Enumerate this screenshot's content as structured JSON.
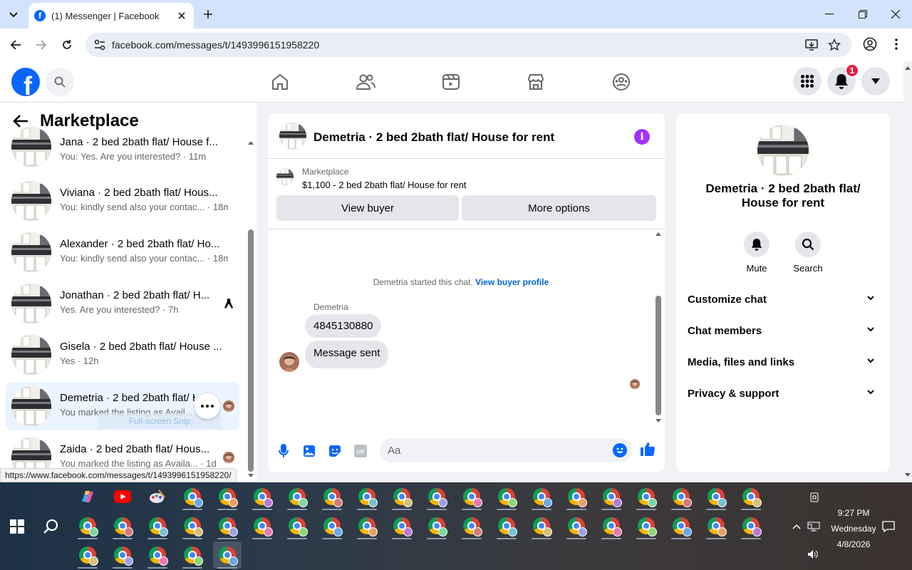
{
  "browser": {
    "tab_title": "(1) Messenger | Facebook",
    "url": "facebook.com/messages/t/1493996151958220",
    "status_url": "https://www.facebook.com/messages/t/1493996151958220/"
  },
  "header": {
    "notification_count": "1"
  },
  "marketplace": {
    "title": "Marketplace",
    "conversations": [
      {
        "name": "Jana · 2 bed 2bath flat/ House f...",
        "preview": "You: Yes. Are you interested? · 11m"
      },
      {
        "name": "Viviana · 2 bed 2bath flat/ Hous...",
        "preview": "You: kindly send also your contac... · 18m"
      },
      {
        "name": "Alexander · 2 bed 2bath flat/ Ho...",
        "preview": "You: kindly send also your contac... · 18m"
      },
      {
        "name": "Jonathan · 2 bed 2bath flat/ H...",
        "preview": "Yes. Are you interested? · 7h"
      },
      {
        "name": "Gisela · 2 bed 2bath flat/ House ...",
        "preview": "Yes · 12h"
      },
      {
        "name": "Demetria · 2 bed 2bath flat/ H...",
        "preview": "You marked the listing as Avail..."
      },
      {
        "name": "Zaida · 2 bed 2bath flat/ Hous...",
        "preview": "You marked the listing as Availa... · 1d"
      }
    ],
    "snip_overlay": "Full-screen Snip"
  },
  "chat": {
    "title": "Demetria · 2 bed 2bath flat/ House for rent",
    "listing_source": "Marketplace",
    "listing_item": "$1,100 - 2 bed 2bath flat/ House for rent",
    "view_buyer_label": "View buyer",
    "more_options_label": "More options",
    "started_text": "Demetria started this chat.",
    "view_profile_link": "View buyer profile",
    "sender_name": "Demetria",
    "messages": [
      "4845130880",
      "Message sent"
    ],
    "input_placeholder": "Aa"
  },
  "details": {
    "name": "Demetria · 2 bed 2bath flat/ House for rent",
    "mute_label": "Mute",
    "search_label": "Search",
    "sections": [
      "Customize chat",
      "Chat members",
      "Media, files and links",
      "Privacy & support"
    ]
  },
  "taskbar": {
    "time": "9:27 PM",
    "day": "Wednesday",
    "date": "4/8/2026"
  },
  "colors": {
    "facebook_blue": "#0866ff",
    "messenger_purple": "#a033ff",
    "badge_red": "#e41e3f"
  }
}
